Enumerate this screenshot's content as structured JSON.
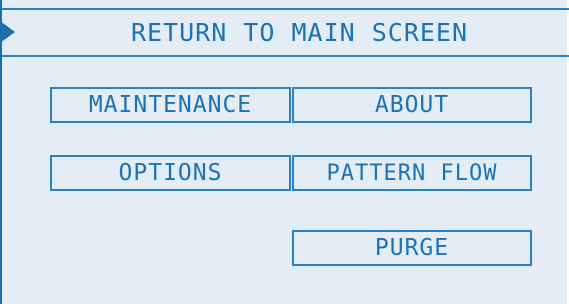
{
  "header": {
    "label": "RETURN TO MAIN SCREEN",
    "icon": "play-arrow-icon"
  },
  "menu": {
    "maintenance_label": "MAINTENANCE",
    "about_label": "ABOUT",
    "options_label": "OPTIONS",
    "pattern_flow_label": "PATTERN FLOW",
    "purge_label": "PURGE"
  },
  "colors": {
    "background": "#e4edf6",
    "accent": "#1a73b8",
    "border": "#2a82c5"
  }
}
